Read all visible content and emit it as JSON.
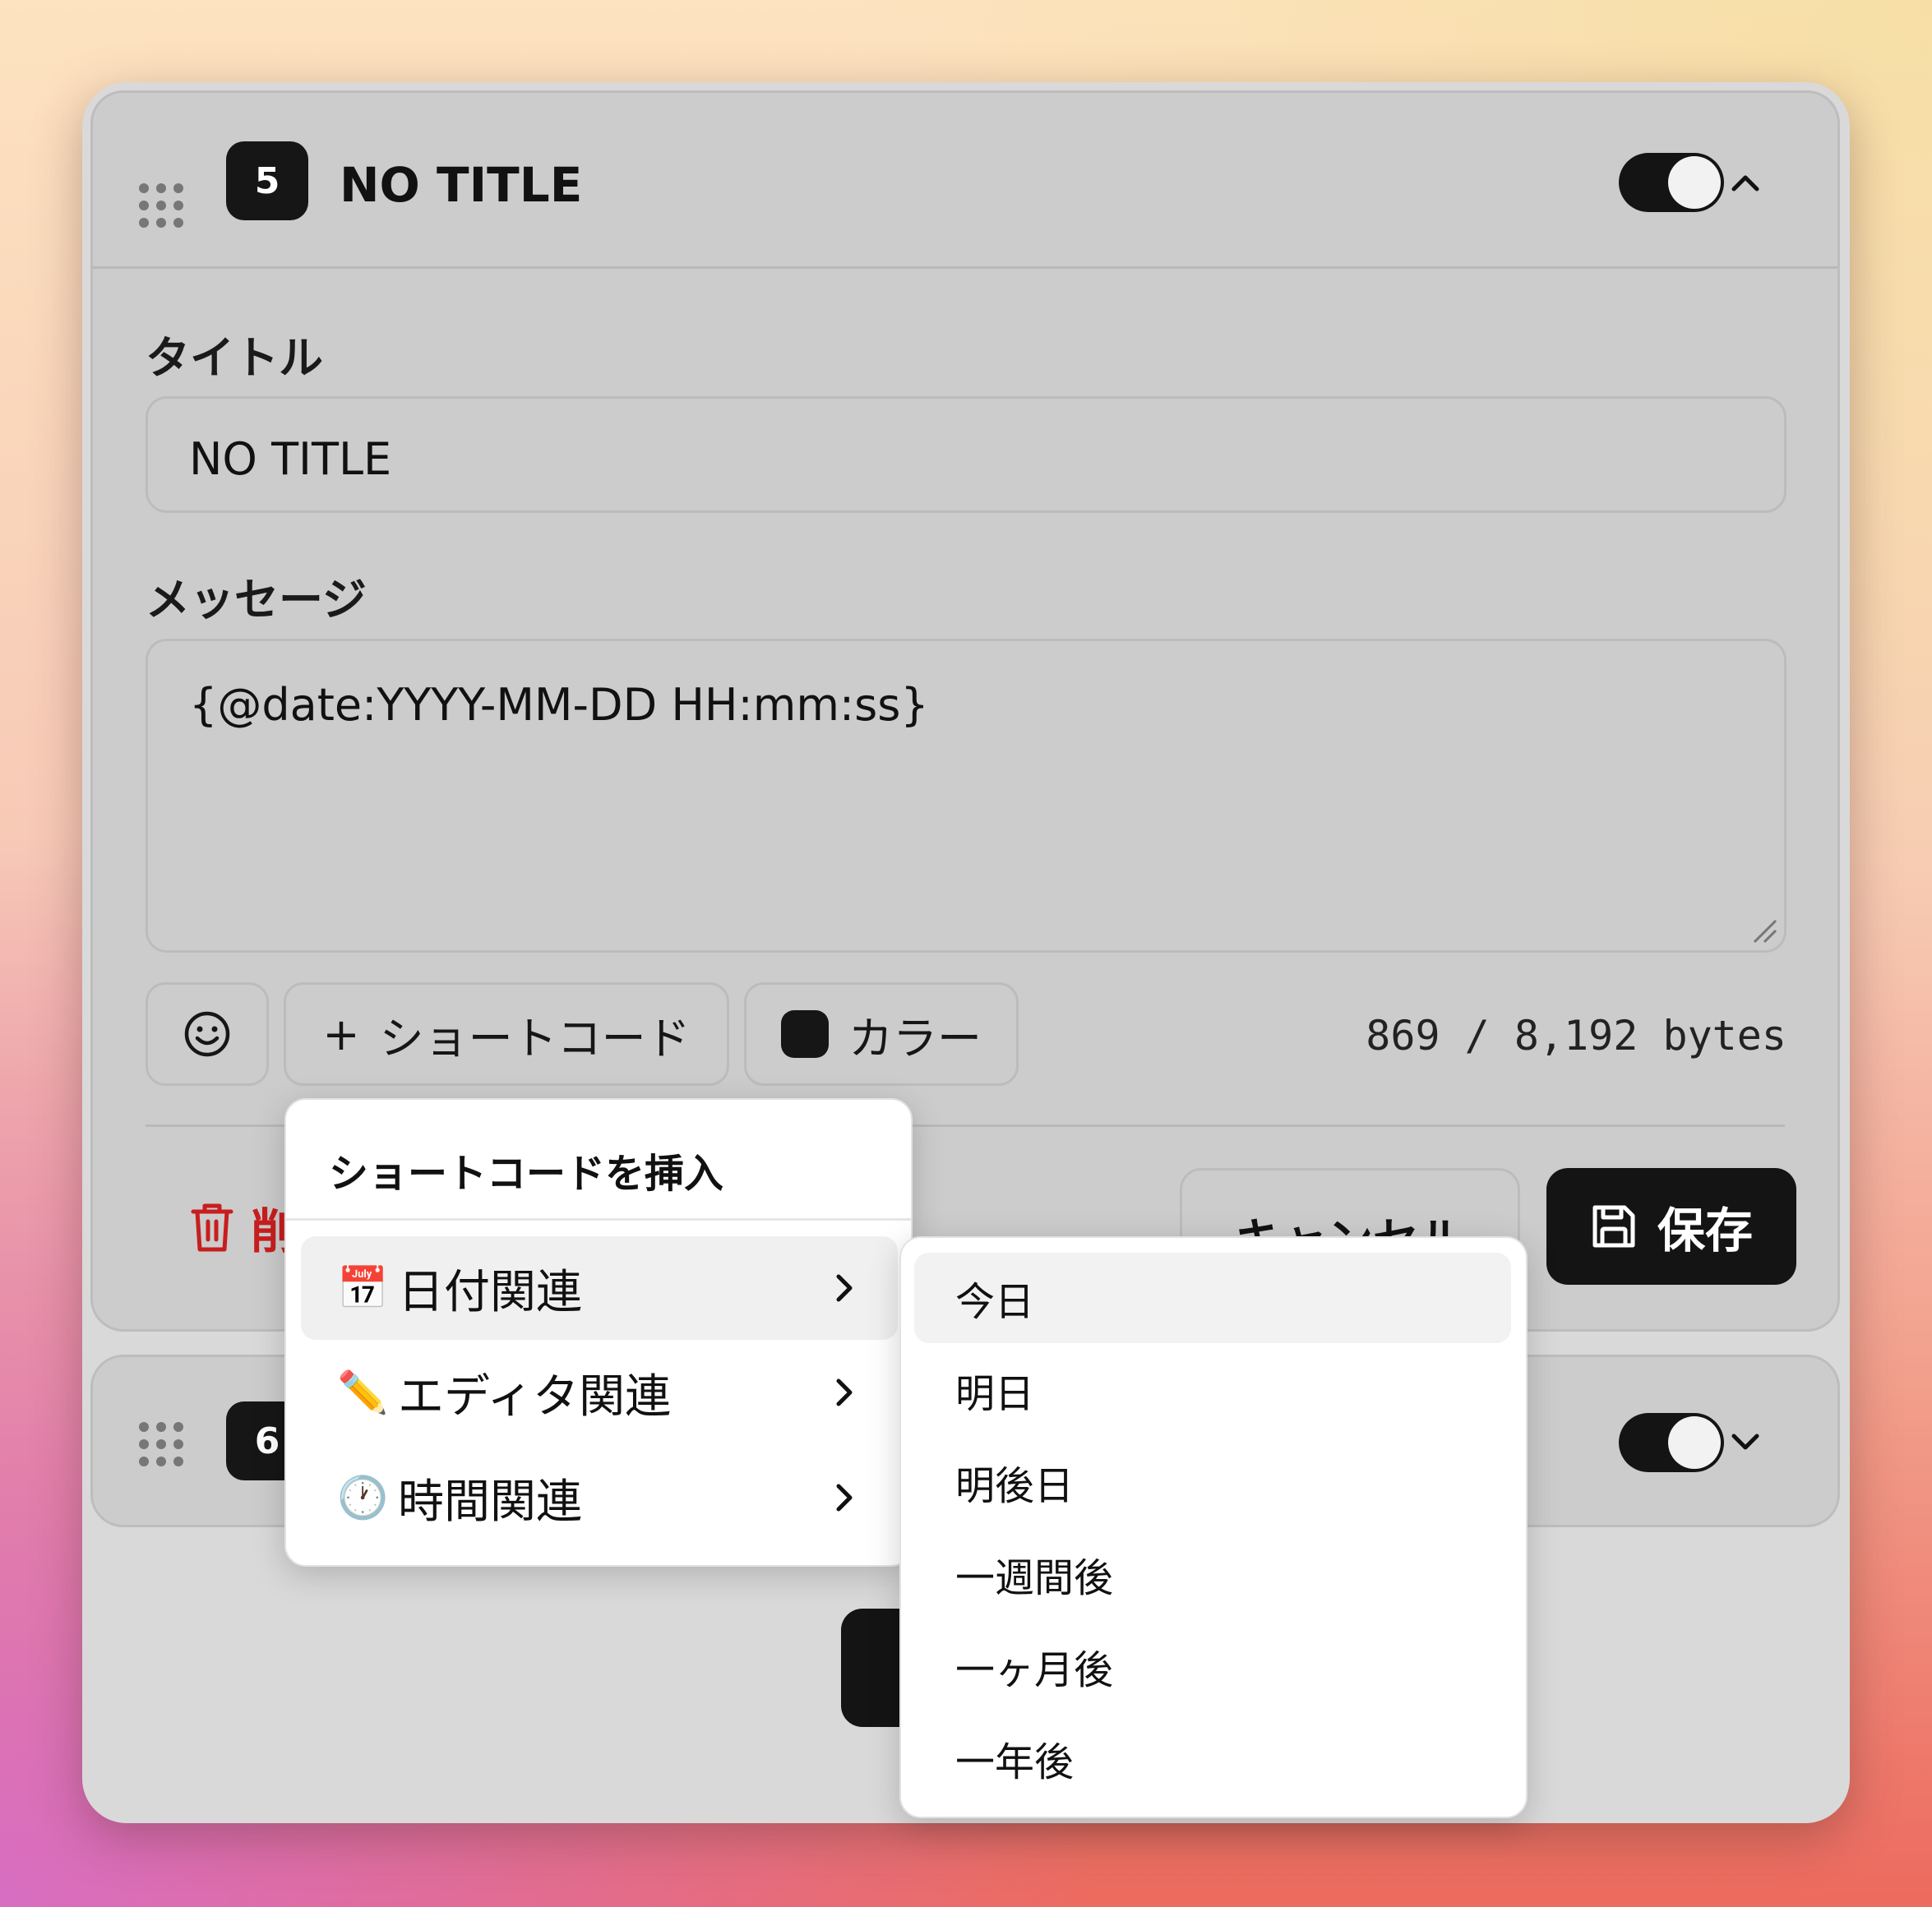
{
  "card1": {
    "number": "5",
    "title": "NO TITLE",
    "toggle_on": true,
    "title_label": "タイトル",
    "title_value": "NO TITLE",
    "message_label": "メッセージ",
    "message_value": "{@date:YYYY-MM-DD HH:mm:ss}",
    "toolbar": {
      "emoji_icon": "smile-icon",
      "shortcode_label": "ショートコード",
      "shortcode_prefix": "+",
      "color_label": "カラー",
      "color_value": "#161616",
      "bytes": "869 / 8,192 bytes"
    },
    "delete_label": "削",
    "cancel_label": "キャンセル",
    "save_label": "保存"
  },
  "card2": {
    "number": "6",
    "toggle_on": true
  },
  "shortcode_menu": {
    "title": "ショートコードを挿入",
    "items": [
      {
        "emoji": "📅",
        "label": "日付関連"
      },
      {
        "emoji": "✏️",
        "label": "エディタ関連"
      },
      {
        "emoji": "🕐",
        "label": "時間関連"
      }
    ],
    "active_index": 0
  },
  "date_submenu": {
    "items": [
      "今日",
      "明日",
      "明後日",
      "一週間後",
      "一ヶ月後",
      "一年後"
    ],
    "active_index": 0
  }
}
